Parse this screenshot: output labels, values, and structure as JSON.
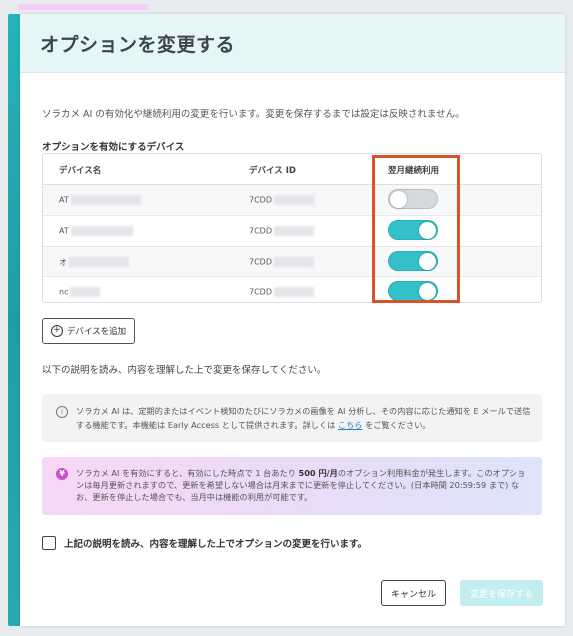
{
  "modal": {
    "title": "オプションを変更する",
    "description": "ソラカメ AI の有効化や継続利用の変更を行います。変更を保存するまでは設定は反映されません。",
    "section_title": "オプションを有効にするデバイス"
  },
  "table": {
    "headers": [
      "デバイス名",
      "デバイス ID",
      "翌月継続利用"
    ],
    "rows": [
      {
        "name": "AT",
        "device_id": "7CDD",
        "renew_enabled": false
      },
      {
        "name": "AT",
        "device_id": "7CDD",
        "renew_enabled": true
      },
      {
        "name": "オ",
        "device_id": "7CDD",
        "renew_enabled": true
      },
      {
        "name": "nc",
        "device_id": "7CDD",
        "renew_enabled": true
      }
    ]
  },
  "add_device_label": "デバイスを追加",
  "instruction": "以下の説明を読み、内容を理解した上で変更を保存してください。",
  "info": {
    "text_before_link": "ソラカメ AI は、定期的またはイベント検知のたびにソラカメの画像を AI 分析し、その内容に応じた通知を E メールで送信する機能です。本機能は Early Access として提供されます。詳しくは ",
    "link": "こちら",
    "text_after_link": " をご覧ください。",
    "icon": "info-icon"
  },
  "warning": {
    "icon": "yen-icon",
    "text_1": "ソラカメ AI を有効にすると、有効にした時点で 1 台あたり ",
    "price": "500 円/月",
    "text_2": "のオプション利用料金が発生します。このオプションは毎月更新されますので、更新を希望しない場合は月末までに更新を停止してください。(日本時間 20:59:59 まで) なお、更新を停止した場合でも、当月中は機能の利用が可能です。"
  },
  "confirm_label": "上記の説明を読み、内容を理解した上でオプションの変更を行います。",
  "buttons": {
    "cancel": "キャンセル",
    "save": "変更を保存する"
  },
  "colors": {
    "accent": "#34c0c8",
    "highlight": "#d8532a",
    "header_bg": "#e6f5f6"
  }
}
